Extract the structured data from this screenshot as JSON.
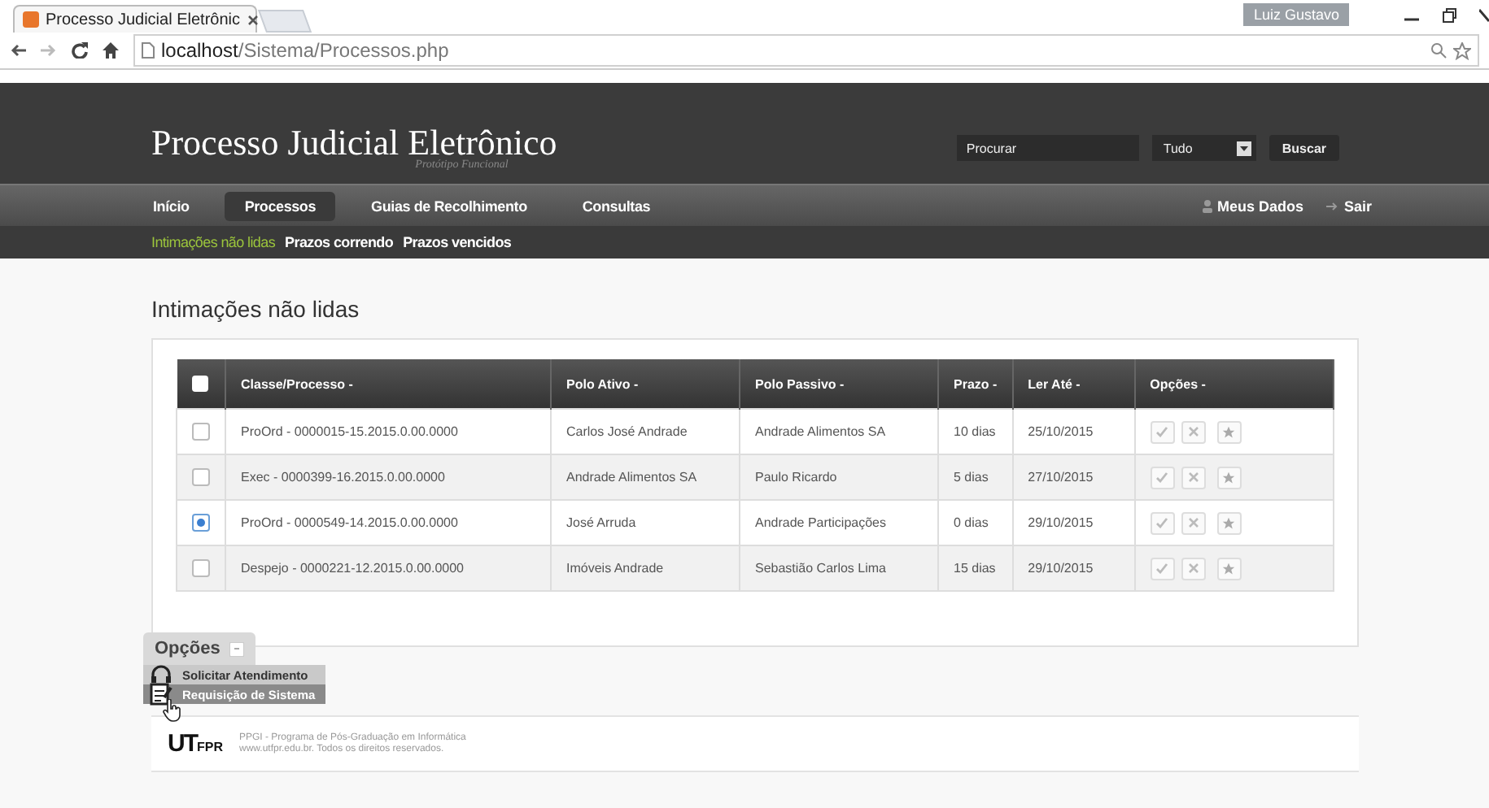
{
  "browser": {
    "tab_title": "Processo Judicial Eletrônic",
    "user_badge": "Luiz Gustavo",
    "url_host": "localhost",
    "url_path": "/Sistema/Processos.php"
  },
  "header": {
    "title": "Processo Judicial Eletrônico",
    "subtitle": "Protótipo Funcional",
    "search_placeholder": "Procurar",
    "filter_value": "Tudo",
    "search_button": "Buscar"
  },
  "nav": {
    "items": [
      {
        "label": "Início",
        "selected": false
      },
      {
        "label": "Processos",
        "selected": true
      },
      {
        "label": "Guias de Recolhimento",
        "selected": false
      },
      {
        "label": "Consultas",
        "selected": false
      }
    ],
    "right_items": [
      {
        "label": "Meus Dados",
        "kind": "user"
      },
      {
        "label": "Sair",
        "kind": "exit"
      }
    ]
  },
  "subnav": {
    "items": [
      {
        "label": "Intimações não lidas",
        "selected": true
      },
      {
        "label": "Prazos correndo",
        "selected": false
      },
      {
        "label": "Prazos vencidos",
        "selected": false
      }
    ]
  },
  "page_title": "Intimações não lidas",
  "table": {
    "all_selected": false,
    "columns": [
      "Classe/Processo -",
      "Polo Ativo -",
      "Polo Passivo -",
      "Prazo -",
      "Ler Até -",
      "Opções -"
    ],
    "rows": [
      {
        "selected": false,
        "cells": [
          "ProOrd - 0000015-15.2015.0.00.0000",
          "Carlos José Andrade",
          "Andrade Alimentos SA",
          "10 dias",
          "25/10/2015"
        ]
      },
      {
        "selected": false,
        "cells": [
          "Exec - 0000399-16.2015.0.00.0000",
          "Andrade Alimentos SA",
          "Paulo Ricardo",
          "5 dias",
          "27/10/2015"
        ]
      },
      {
        "selected": true,
        "cells": [
          "ProOrd - 0000549-14.2015.0.00.0000",
          "José Arruda",
          "Andrade Participações",
          "0 dias",
          "29/10/2015"
        ]
      },
      {
        "selected": false,
        "cells": [
          "Despejo - 0000221-12.2015.0.00.0000",
          "Imóveis Andrade",
          "Sebastião Carlos Lima",
          "15 dias",
          "29/10/2015"
        ]
      }
    ]
  },
  "options_menu": {
    "label": "Opções",
    "expanded": true,
    "items": [
      {
        "label": "Solicitar Atendimento",
        "kind": "headset",
        "highlighted": false
      },
      {
        "label": "Requisição de Sistema",
        "kind": "form",
        "highlighted": true
      }
    ]
  },
  "footer": {
    "logo_main": "UT",
    "logo_small": "FPR",
    "lines": [
      "PPGI - Programa de Pós-Graduação em Informática",
      "www.utfpr.edu.br. Todos os direitos reservados."
    ]
  }
}
